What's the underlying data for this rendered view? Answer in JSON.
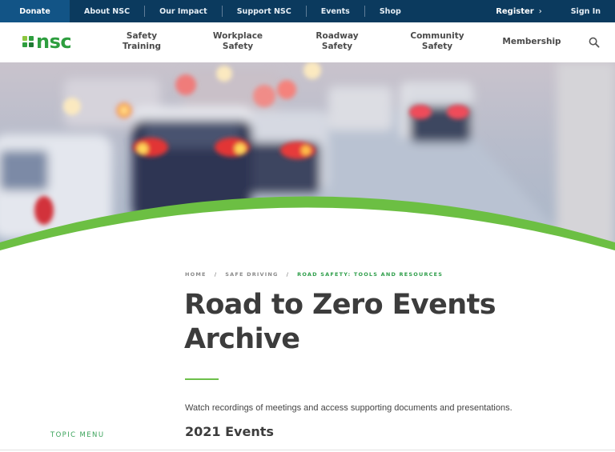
{
  "utility_bar": {
    "donate": "Donate",
    "links": [
      "About NSC",
      "Our Impact",
      "Support NSC",
      "Events",
      "Shop"
    ],
    "register": "Register",
    "register_chevron": "›",
    "sign_in": "Sign In"
  },
  "brand": {
    "logo_text": "nsc",
    "colors": {
      "navy": "#0b3a5e",
      "donate_blue": "#125486",
      "green": "#2e9e3f",
      "light_green": "#6cbf4a",
      "title_gray": "#3c3c3c"
    }
  },
  "main_nav": {
    "items": [
      {
        "line1": "Safety",
        "line2": "Training"
      },
      {
        "line1": "Workplace",
        "line2": "Safety"
      },
      {
        "line1": "Roadway",
        "line2": "Safety"
      },
      {
        "line1": "Community",
        "line2": "Safety"
      },
      {
        "line1": "Membership",
        "line2": ""
      }
    ],
    "search_icon": "search-icon"
  },
  "hero": {
    "image_description": "blurred traffic with red tail lights"
  },
  "breadcrumb": {
    "items": [
      "HOME",
      "SAFE DRIVING",
      "ROAD SAFETY: TOOLS AND RESOURCES"
    ],
    "separator": "/"
  },
  "page": {
    "title_line1": "Road to Zero Events",
    "title_line2": "Archive",
    "intro": "Watch recordings of meetings and access supporting documents and presentations.",
    "section_heading": "2021 Events"
  },
  "sidebar": {
    "topic_menu": "TOPIC MENU"
  }
}
